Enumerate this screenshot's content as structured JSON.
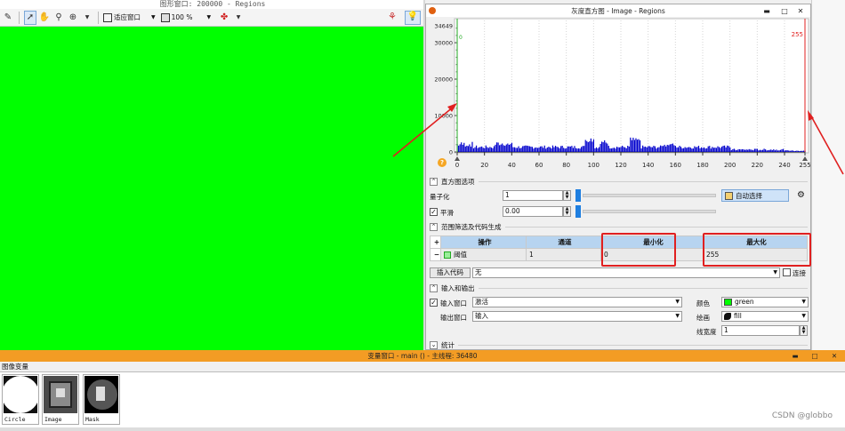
{
  "graphics_window": {
    "title": "图形窗口: 200000 - Regions",
    "zoom_mode": "适应窗口",
    "zoom_value": "100 %"
  },
  "histogram_dialog": {
    "title": "灰度直方图 - Image - Regions",
    "help_icon": "?",
    "options_header": "直方图选项",
    "quantize_label": "量子化",
    "quantize_value": "1",
    "auto_select_label": "自动选择",
    "smooth_label": "平滑",
    "smooth_value": "0.00",
    "range_header": "范围筛选及代码生成",
    "table_headers": [
      "+",
      "操作",
      "通道",
      "最小化",
      "最大化"
    ],
    "table_row": {
      "minus": "−",
      "op": "阈值",
      "channel": "1",
      "min": "0",
      "max": "255"
    },
    "insert_code_label": "插入代码",
    "insert_code_value": "无",
    "link_label": "连接",
    "io_header": "输入和输出",
    "input_window_label": "输入窗口",
    "input_window_value": "激活",
    "output_window_label": "输出窗口",
    "output_window_value": "输入",
    "color_label": "颜色",
    "color_value": "green",
    "draw_label": "绘画",
    "draw_value": "fill",
    "linewidth_label": "线宽度",
    "linewidth_value": "1",
    "stats_header": "统计"
  },
  "chart_data": {
    "type": "bar",
    "xlim": [
      0,
      255
    ],
    "ylim": [
      0,
      34649
    ],
    "y_max_label": "34649",
    "y_ticks": [
      "30000",
      "20000",
      "10000",
      "0"
    ],
    "x_ticks": [
      "0",
      "20",
      "40",
      "60",
      "80",
      "100",
      "120",
      "140",
      "160",
      "180",
      "200",
      "220",
      "240",
      "255"
    ],
    "marker_right_label": "255",
    "marker_left_label": "0",
    "bars_color": "#0000cc"
  },
  "variable_window": {
    "title": "变量窗口 - main () - 主线程: 36480",
    "section_label": "图像变量",
    "thumbnails": [
      "Circle",
      "Image",
      "Mask"
    ]
  },
  "watermark": "CSDN @globbo"
}
